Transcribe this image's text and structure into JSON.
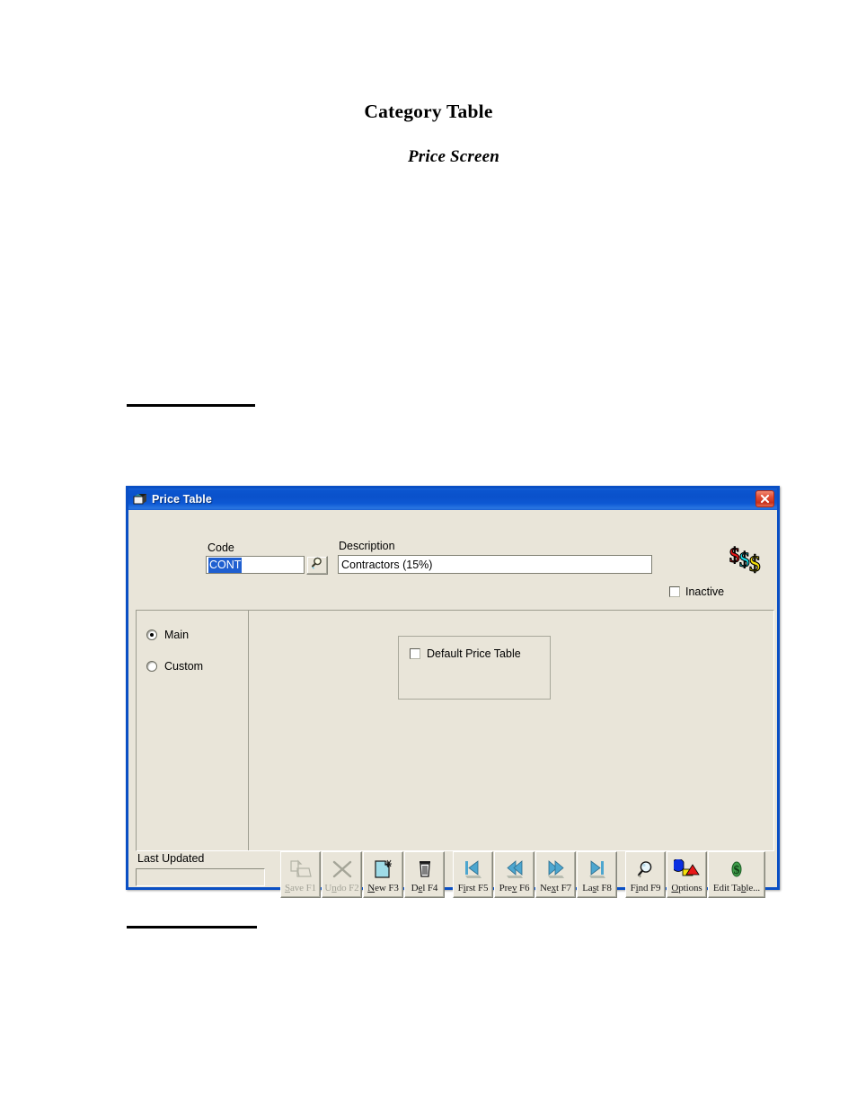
{
  "document": {
    "title": "Category Table",
    "subtitle": "Price Screen"
  },
  "window": {
    "title": "Price Table",
    "icon": "window-app-icon",
    "close_icon": "close-icon",
    "decor_icon": "dollar-signs-icon"
  },
  "header": {
    "code_label": "Code",
    "code_value": "CONT",
    "code_lookup_icon": "magnifier-icon",
    "description_label": "Description",
    "description_value": "Contractors (15%)",
    "inactive_label": "Inactive",
    "inactive_checked": false
  },
  "left_pane": {
    "options": [
      {
        "label": "Main",
        "selected": true
      },
      {
        "label": "Custom",
        "selected": false
      }
    ]
  },
  "group_box": {
    "default_price_table_label": "Default Price Table",
    "default_price_table_checked": false
  },
  "footer": {
    "last_updated_label": "Last Updated",
    "last_updated_value": "",
    "buttons": [
      {
        "label_pre": "S",
        "label_key": "a",
        "label_post": "ve F1",
        "name": "save-button",
        "icon": "save-icon",
        "disabled": true
      },
      {
        "label_pre": "U",
        "label_key": "n",
        "label_post": "do F2",
        "name": "undo-button",
        "icon": "undo-x-icon",
        "disabled": true
      },
      {
        "label_pre": "",
        "label_key": "N",
        "label_post": "ew F3",
        "name": "new-button",
        "icon": "new-document-icon",
        "disabled": false
      },
      {
        "label_pre": "D",
        "label_key": "e",
        "label_post": "l F4",
        "name": "delete-button",
        "icon": "trash-icon",
        "disabled": false
      },
      {
        "label_pre": "F",
        "label_key": "i",
        "label_post": "rst F5",
        "name": "first-button",
        "icon": "first-record-icon",
        "disabled": false
      },
      {
        "label_pre": "Pre",
        "label_key": "v",
        "label_post": " F6",
        "name": "prev-button",
        "icon": "prev-record-icon",
        "disabled": false
      },
      {
        "label_pre": "Ne",
        "label_key": "x",
        "label_post": "t F7",
        "name": "next-button",
        "icon": "next-record-icon",
        "disabled": false
      },
      {
        "label_pre": "La",
        "label_key": "s",
        "label_post": "t F8",
        "name": "last-button",
        "icon": "last-record-icon",
        "disabled": false
      },
      {
        "label_pre": "F",
        "label_key": "i",
        "label_post": "nd F9",
        "name": "find-button",
        "icon": "magnifier-icon",
        "disabled": false
      },
      {
        "label_pre": "",
        "label_key": "O",
        "label_post": "ptions",
        "name": "options-button",
        "icon": "shapes-icon",
        "disabled": false
      },
      {
        "label_pre": "Edit Ta",
        "label_key": "b",
        "label_post": "le...",
        "name": "edit-table-button",
        "icon": "dollar-leaf-icon",
        "disabled": false
      }
    ]
  },
  "colors": {
    "dialog_face": "#e9e5d9",
    "title_blue": "#0a51cb",
    "selection_blue": "#1f5fd0",
    "close_red": "#c7301a"
  }
}
